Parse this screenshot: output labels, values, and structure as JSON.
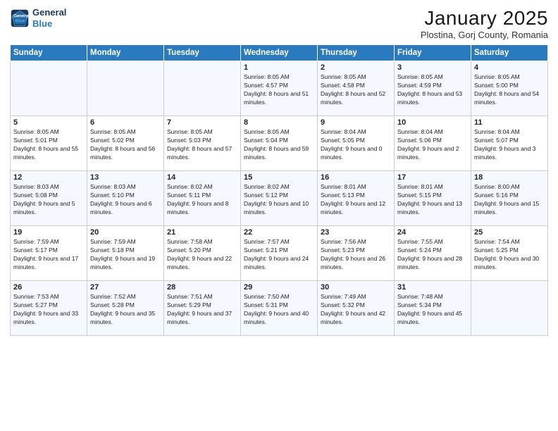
{
  "header": {
    "logo_line1": "General",
    "logo_line2": "Blue",
    "title": "January 2025",
    "subtitle": "Plostina, Gorj County, Romania"
  },
  "weekdays": [
    "Sunday",
    "Monday",
    "Tuesday",
    "Wednesday",
    "Thursday",
    "Friday",
    "Saturday"
  ],
  "weeks": [
    [
      {
        "day": "",
        "info": ""
      },
      {
        "day": "",
        "info": ""
      },
      {
        "day": "",
        "info": ""
      },
      {
        "day": "1",
        "info": "Sunrise: 8:05 AM\nSunset: 4:57 PM\nDaylight: 8 hours and 51 minutes."
      },
      {
        "day": "2",
        "info": "Sunrise: 8:05 AM\nSunset: 4:58 PM\nDaylight: 8 hours and 52 minutes."
      },
      {
        "day": "3",
        "info": "Sunrise: 8:05 AM\nSunset: 4:59 PM\nDaylight: 8 hours and 53 minutes."
      },
      {
        "day": "4",
        "info": "Sunrise: 8:05 AM\nSunset: 5:00 PM\nDaylight: 8 hours and 54 minutes."
      }
    ],
    [
      {
        "day": "5",
        "info": "Sunrise: 8:05 AM\nSunset: 5:01 PM\nDaylight: 8 hours and 55 minutes."
      },
      {
        "day": "6",
        "info": "Sunrise: 8:05 AM\nSunset: 5:02 PM\nDaylight: 8 hours and 56 minutes."
      },
      {
        "day": "7",
        "info": "Sunrise: 8:05 AM\nSunset: 5:03 PM\nDaylight: 8 hours and 57 minutes."
      },
      {
        "day": "8",
        "info": "Sunrise: 8:05 AM\nSunset: 5:04 PM\nDaylight: 8 hours and 59 minutes."
      },
      {
        "day": "9",
        "info": "Sunrise: 8:04 AM\nSunset: 5:05 PM\nDaylight: 9 hours and 0 minutes."
      },
      {
        "day": "10",
        "info": "Sunrise: 8:04 AM\nSunset: 5:06 PM\nDaylight: 9 hours and 2 minutes."
      },
      {
        "day": "11",
        "info": "Sunrise: 8:04 AM\nSunset: 5:07 PM\nDaylight: 9 hours and 3 minutes."
      }
    ],
    [
      {
        "day": "12",
        "info": "Sunrise: 8:03 AM\nSunset: 5:08 PM\nDaylight: 9 hours and 5 minutes."
      },
      {
        "day": "13",
        "info": "Sunrise: 8:03 AM\nSunset: 5:10 PM\nDaylight: 9 hours and 6 minutes."
      },
      {
        "day": "14",
        "info": "Sunrise: 8:02 AM\nSunset: 5:11 PM\nDaylight: 9 hours and 8 minutes."
      },
      {
        "day": "15",
        "info": "Sunrise: 8:02 AM\nSunset: 5:12 PM\nDaylight: 9 hours and 10 minutes."
      },
      {
        "day": "16",
        "info": "Sunrise: 8:01 AM\nSunset: 5:13 PM\nDaylight: 9 hours and 12 minutes."
      },
      {
        "day": "17",
        "info": "Sunrise: 8:01 AM\nSunset: 5:15 PM\nDaylight: 9 hours and 13 minutes."
      },
      {
        "day": "18",
        "info": "Sunrise: 8:00 AM\nSunset: 5:16 PM\nDaylight: 9 hours and 15 minutes."
      }
    ],
    [
      {
        "day": "19",
        "info": "Sunrise: 7:59 AM\nSunset: 5:17 PM\nDaylight: 9 hours and 17 minutes."
      },
      {
        "day": "20",
        "info": "Sunrise: 7:59 AM\nSunset: 5:18 PM\nDaylight: 9 hours and 19 minutes."
      },
      {
        "day": "21",
        "info": "Sunrise: 7:58 AM\nSunset: 5:20 PM\nDaylight: 9 hours and 22 minutes."
      },
      {
        "day": "22",
        "info": "Sunrise: 7:57 AM\nSunset: 5:21 PM\nDaylight: 9 hours and 24 minutes."
      },
      {
        "day": "23",
        "info": "Sunrise: 7:56 AM\nSunset: 5:23 PM\nDaylight: 9 hours and 26 minutes."
      },
      {
        "day": "24",
        "info": "Sunrise: 7:55 AM\nSunset: 5:24 PM\nDaylight: 9 hours and 28 minutes."
      },
      {
        "day": "25",
        "info": "Sunrise: 7:54 AM\nSunset: 5:25 PM\nDaylight: 9 hours and 30 minutes."
      }
    ],
    [
      {
        "day": "26",
        "info": "Sunrise: 7:53 AM\nSunset: 5:27 PM\nDaylight: 9 hours and 33 minutes."
      },
      {
        "day": "27",
        "info": "Sunrise: 7:52 AM\nSunset: 5:28 PM\nDaylight: 9 hours and 35 minutes."
      },
      {
        "day": "28",
        "info": "Sunrise: 7:51 AM\nSunset: 5:29 PM\nDaylight: 9 hours and 37 minutes."
      },
      {
        "day": "29",
        "info": "Sunrise: 7:50 AM\nSunset: 5:31 PM\nDaylight: 9 hours and 40 minutes."
      },
      {
        "day": "30",
        "info": "Sunrise: 7:49 AM\nSunset: 5:32 PM\nDaylight: 9 hours and 42 minutes."
      },
      {
        "day": "31",
        "info": "Sunrise: 7:48 AM\nSunset: 5:34 PM\nDaylight: 9 hours and 45 minutes."
      },
      {
        "day": "",
        "info": ""
      }
    ]
  ]
}
